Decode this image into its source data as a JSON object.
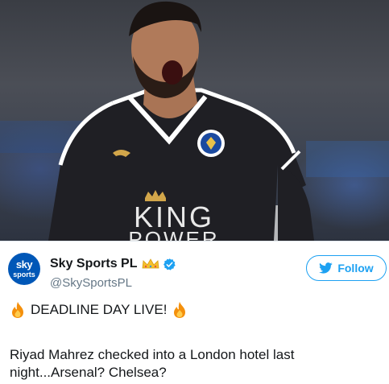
{
  "tweet": {
    "photo": {
      "shirt_text_line1": "KING",
      "shirt_text_line2": "POWER"
    },
    "author": {
      "avatar_line1": "sky",
      "avatar_line2": "sports",
      "name": "Sky Sports PL",
      "handle": "@SkySportsPL",
      "verified": true
    },
    "follow_label": "Follow",
    "headline": "DEADLINE DAY LIVE!",
    "body": "Riyad Mahrez checked into a London hotel last night...Arsenal? Chelsea?",
    "colors": {
      "accent": "#1da1f2",
      "text": "#14171a",
      "secondary": "#657786",
      "avatar_bg": "#0057b7"
    },
    "icons": [
      "crown-emoji",
      "verified-badge-icon",
      "twitter-bird-icon",
      "fire-emoji"
    ]
  }
}
